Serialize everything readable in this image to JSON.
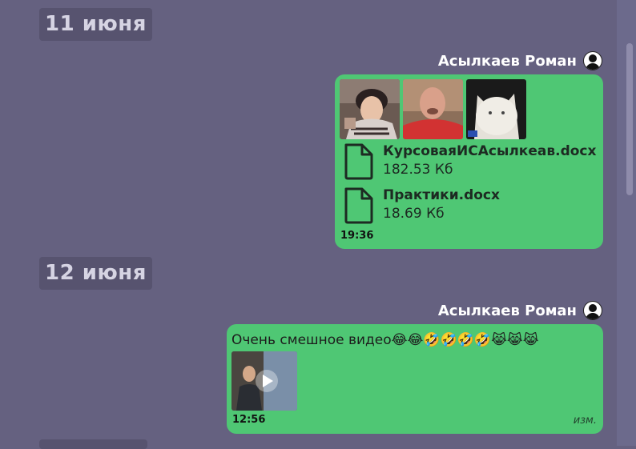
{
  "dates": {
    "first": "11 июня",
    "second": "12 июня"
  },
  "messages": [
    {
      "sender": "Асылкаев Роман",
      "photos": [
        "person-photo",
        "bald-man-photo",
        "cat-photo"
      ],
      "files": [
        {
          "name": "КурсоваяИСАсылкеав.docx",
          "size": "182.53 Кб"
        },
        {
          "name": "Практики.docx",
          "size": "18.69 Кб"
        }
      ],
      "time": "19:36"
    },
    {
      "sender": "Асылкаев Роман",
      "text": "Очень смешное видео",
      "emojis": "😂😂🤣🤣🤣🤣😹😹😹",
      "video": "video-thumbnail",
      "time": "12:56",
      "edited": "изм."
    }
  ],
  "colors": {
    "background": "#656180",
    "bubble": "#4fc774",
    "date_badge": "#57536f"
  }
}
